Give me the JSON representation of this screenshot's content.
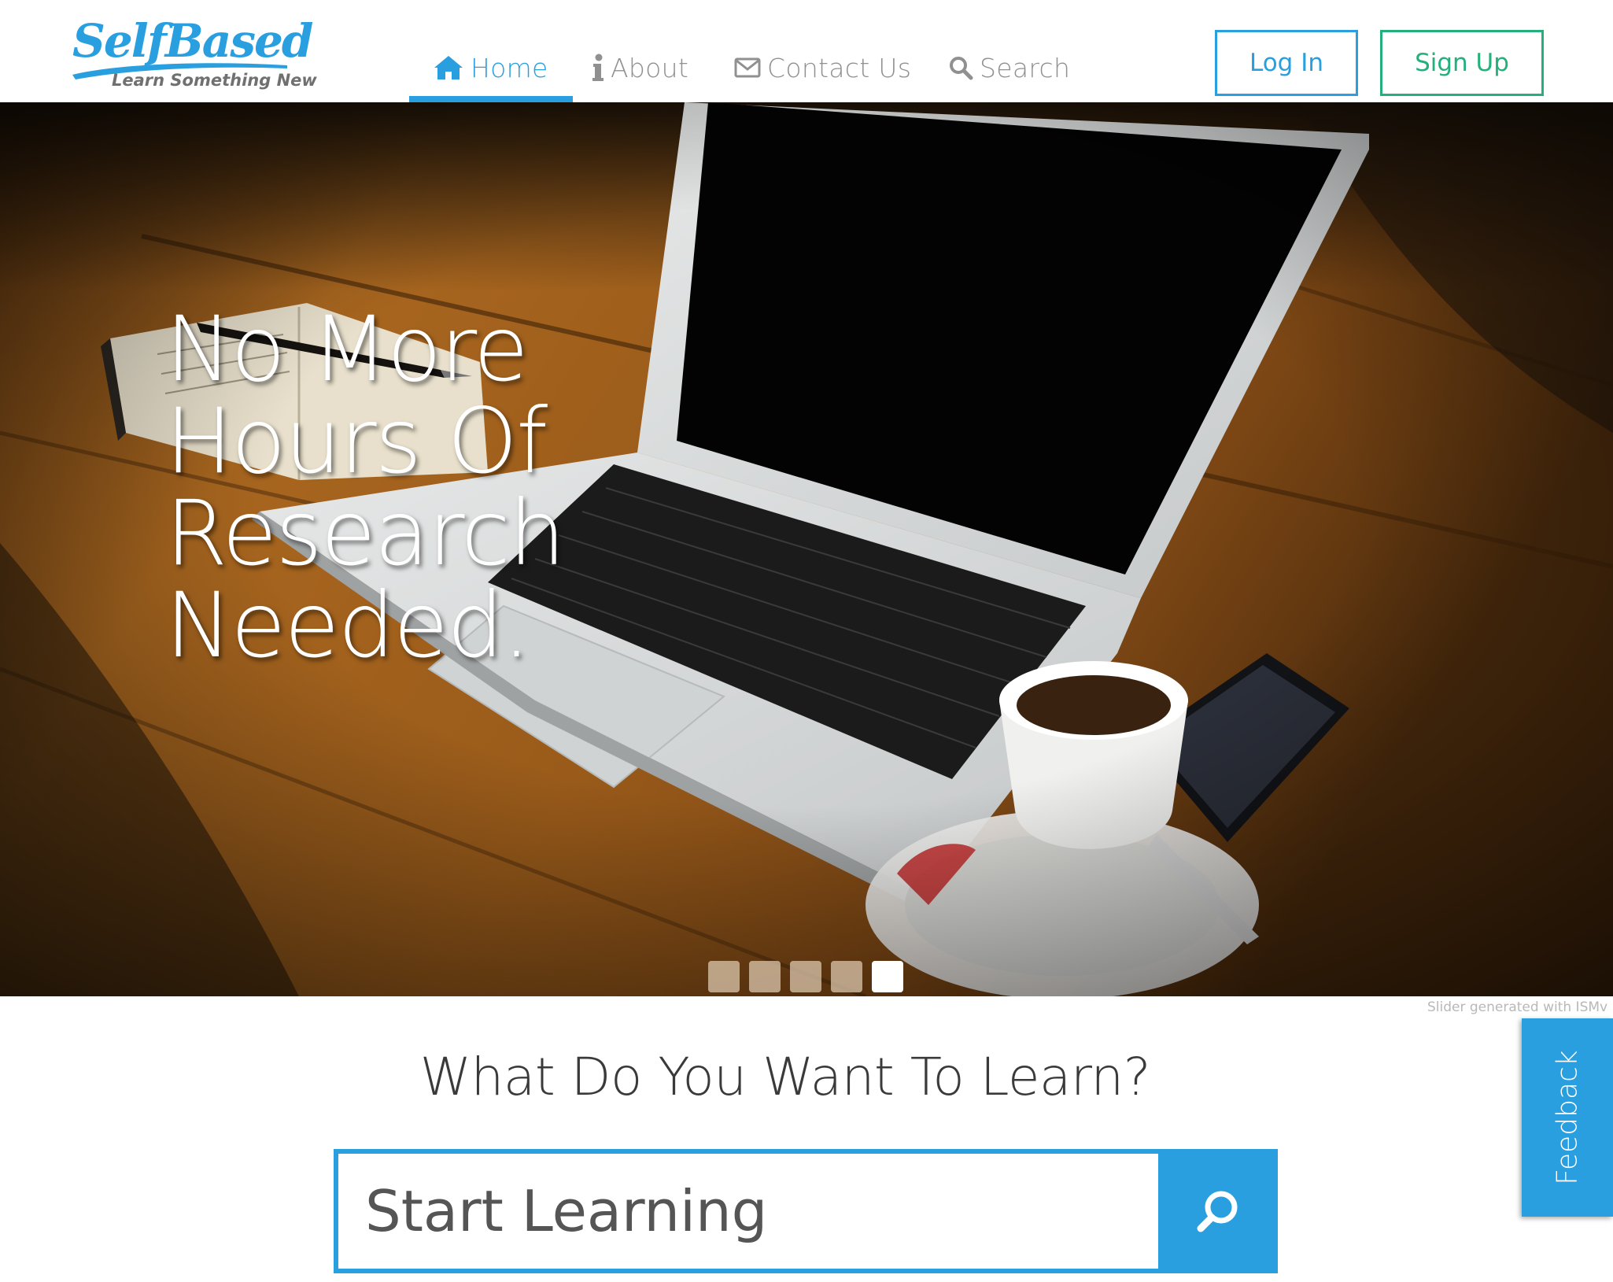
{
  "header": {
    "logo": {
      "title": "SelfBased",
      "tagline": "Learn Something New"
    },
    "nav": [
      {
        "label": "Home",
        "icon": "home-icon",
        "active": true
      },
      {
        "label": "About",
        "icon": "info-icon",
        "active": false
      },
      {
        "label": "Contact Us",
        "icon": "envelope-icon",
        "active": false
      },
      {
        "label": "Search",
        "icon": "search-icon",
        "active": false
      }
    ],
    "login_label": "Log In",
    "signup_label": "Sign Up"
  },
  "hero": {
    "headline_lines": [
      "No More",
      "Hours Of",
      "Research",
      "Needed."
    ],
    "slides_count": 5,
    "active_slide": 5,
    "credit": "Slider generated with ISMv"
  },
  "learn": {
    "title": "What Do You Want To Learn?",
    "search_placeholder": "Start Learning"
  },
  "feedback": {
    "label": "Feedback"
  },
  "colors": {
    "accent": "#2a9fe0",
    "signup": "#23b07d",
    "nav_text": "#909090"
  }
}
